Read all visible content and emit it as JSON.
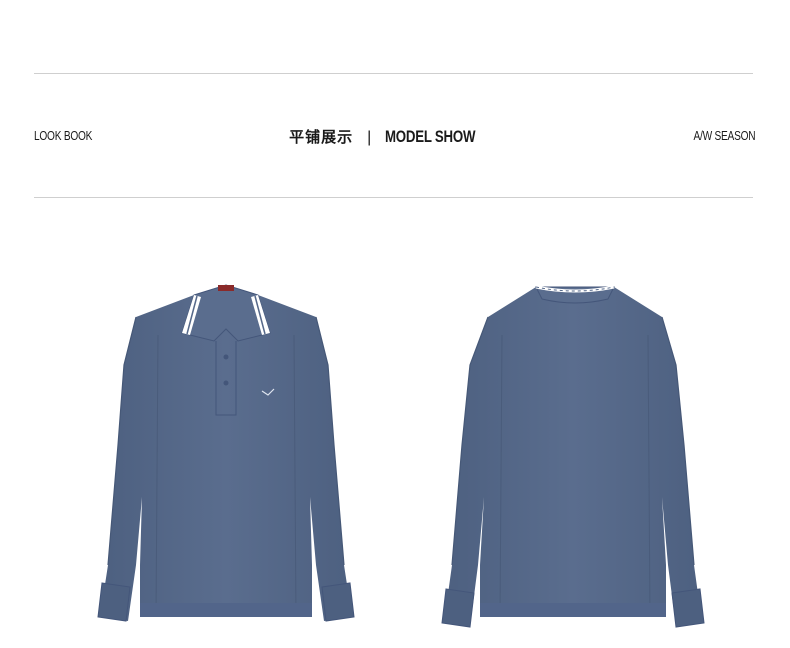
{
  "header": {
    "left_label": "LOOK BOOK",
    "title_cn": "平铺展示",
    "separator": "|",
    "title_en": "MODEL SHOW",
    "right_label": "A/W SEASON"
  },
  "colors": {
    "garment": "#56698a",
    "garment_shadow": "#4a5c7b",
    "collar_tip": "#ffffff",
    "rule": "#cfcfcf"
  },
  "images": [
    {
      "name": "polo-front",
      "view": "front"
    },
    {
      "name": "polo-back",
      "view": "back"
    }
  ]
}
